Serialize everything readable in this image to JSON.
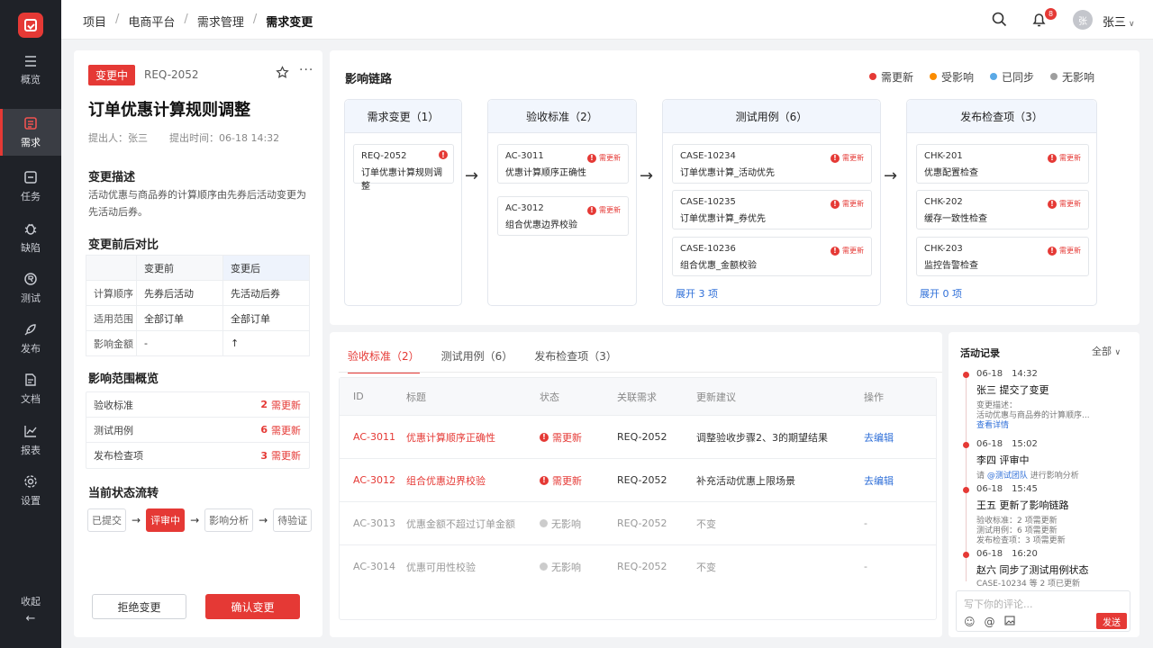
{
  "sidebar": {
    "items": [
      {
        "label": "概览",
        "icon": "menu-icon"
      },
      {
        "label": "需求",
        "icon": "document-icon",
        "active": true
      },
      {
        "label": "任务",
        "icon": "checkbox-icon"
      },
      {
        "label": "缺陷",
        "icon": "bug-icon"
      },
      {
        "label": "测试",
        "icon": "test-icon"
      },
      {
        "label": "发布",
        "icon": "rocket-icon"
      },
      {
        "label": "文档",
        "icon": "file-icon"
      },
      {
        "label": "报表",
        "icon": "chart-icon"
      },
      {
        "label": "设置",
        "icon": "gear-icon"
      }
    ],
    "collapse_label": "收起",
    "collapse_arrow": "←"
  },
  "header": {
    "breadcrumb": [
      "项目",
      "电商平台",
      "需求管理",
      "需求变更"
    ],
    "separator": "/",
    "notification_count": "8",
    "avatar_text": "张",
    "username": "张三"
  },
  "detail": {
    "status": "变更中",
    "req_id": "REQ-2052",
    "more": "···",
    "title": "订单优惠计算规则调整",
    "submitter": "提出人：张三",
    "submit_time": "提出时间：06-18 14:32",
    "desc_title": "变更描述",
    "desc": "活动优惠与商品券的计算顺序由先券后活动变更为先活动后券。",
    "compare_title": "变更前后对比",
    "compare_headers": [
      "",
      "变更前",
      "变更后"
    ],
    "compare_rows": [
      [
        "计算顺序",
        "先券后活动",
        "先活动后券"
      ],
      [
        "适用范围",
        "全部订单",
        "全部订单"
      ],
      [
        "影响金额",
        "-",
        "↑"
      ]
    ],
    "scope_title": "影响范围概览",
    "scope_rows": [
      {
        "name": "验收标准",
        "count": "2",
        "label": "需更新"
      },
      {
        "name": "测试用例",
        "count": "6",
        "label": "需更新"
      },
      {
        "name": "发布检查项",
        "count": "3",
        "label": "需更新"
      }
    ],
    "flow_title": "当前状态流转",
    "flow_steps": [
      "已提交",
      "评审中",
      "影响分析",
      "待验证"
    ],
    "flow_arrow": "→",
    "reject_label": "拒绝变更",
    "confirm_label": "确认变更"
  },
  "chain": {
    "title": "影响链路",
    "legend": [
      {
        "label": "需更新",
        "color": "#e53935"
      },
      {
        "label": "受影响",
        "color": "#fb8c00"
      },
      {
        "label": "已同步",
        "color": "#5aa9e6"
      },
      {
        "label": "无影响",
        "color": "#9e9e9e"
      }
    ],
    "arrow": "→",
    "flag_mark": "!",
    "columns": [
      {
        "head": "需求变更（1）",
        "cards": [
          {
            "id": "REQ-2052",
            "name": "订单优惠计算规则调整",
            "flag": ""
          }
        ],
        "expand": ""
      },
      {
        "head": "验收标准（2）",
        "cards": [
          {
            "id": "AC-3011",
            "name": "优惠计算顺序正确性",
            "flag": "需更新"
          },
          {
            "id": "AC-3012",
            "name": "组合优惠边界校验",
            "flag": "需更新"
          }
        ],
        "expand": ""
      },
      {
        "head": "测试用例（6）",
        "cards": [
          {
            "id": "CASE-10234",
            "name": "订单优惠计算_活动优先",
            "flag": "需更新"
          },
          {
            "id": "CASE-10235",
            "name": "订单优惠计算_券优先",
            "flag": "需更新"
          },
          {
            "id": "CASE-10236",
            "name": "组合优惠_金额校验",
            "flag": "需更新"
          }
        ],
        "expand": "展开 3 项"
      },
      {
        "head": "发布检查项（3）",
        "cards": [
          {
            "id": "CHK-201",
            "name": "优惠配置检查",
            "flag": "需更新"
          },
          {
            "id": "CHK-202",
            "name": "缓存一致性检查",
            "flag": "需更新"
          },
          {
            "id": "CHK-203",
            "name": "监控告警检查",
            "flag": "需更新"
          }
        ],
        "expand": "展开 0 项"
      }
    ]
  },
  "table": {
    "tabs": [
      "验收标准（2）",
      "测试用例（6）",
      "发布检查项（3）"
    ],
    "headers": [
      "ID",
      "标题",
      "状态",
      "关联需求",
      "更新建议",
      "操作"
    ],
    "rows": [
      {
        "id": "AC-3011",
        "title": "优惠计算顺序正确性",
        "status": "需更新",
        "req": "REQ-2052",
        "suggest": "调整验收步骤2、3的期望结果",
        "action": "去编辑"
      },
      {
        "id": "AC-3012",
        "title": "组合优惠边界校验",
        "status": "需更新",
        "req": "REQ-2052",
        "suggest": "补充活动优惠上限场景",
        "action": "去编辑"
      },
      {
        "id": "AC-3013",
        "title": "优惠金额不超过订单金额",
        "status": "无影响",
        "req": "REQ-2052",
        "suggest": "不变",
        "action": "-"
      },
      {
        "id": "AC-3014",
        "title": "优惠可用性校验",
        "status": "无影响",
        "req": "REQ-2052",
        "suggest": "不变",
        "action": "-"
      }
    ]
  },
  "activity": {
    "title": "活动记录",
    "filter": "全部",
    "events": [
      {
        "date": "06-18",
        "time": "14:32",
        "head": "张三 提交了变更",
        "sub": [
          "变更描述：",
          "活动优惠与商品券的计算顺序..."
        ],
        "link": "查看详情"
      },
      {
        "date": "06-18",
        "time": "15:02",
        "head": "李四 评审中",
        "sub_pre": "请 ",
        "mention": "@测试团队",
        "sub_post": " 进行影响分析"
      },
      {
        "date": "06-18",
        "time": "15:45",
        "head": "王五 更新了影响链路",
        "sub": [
          "验收标准：2 项需更新",
          "测试用例：6 项需更新",
          "发布检查项：3 项需更新"
        ]
      },
      {
        "date": "06-18",
        "time": "16:20",
        "head": "赵六 同步了测试用例状态",
        "sub": [
          "CASE-10234 等 2 项已更新"
        ]
      }
    ],
    "comment_placeholder": "写下你的评论...",
    "send_label": "发送"
  }
}
